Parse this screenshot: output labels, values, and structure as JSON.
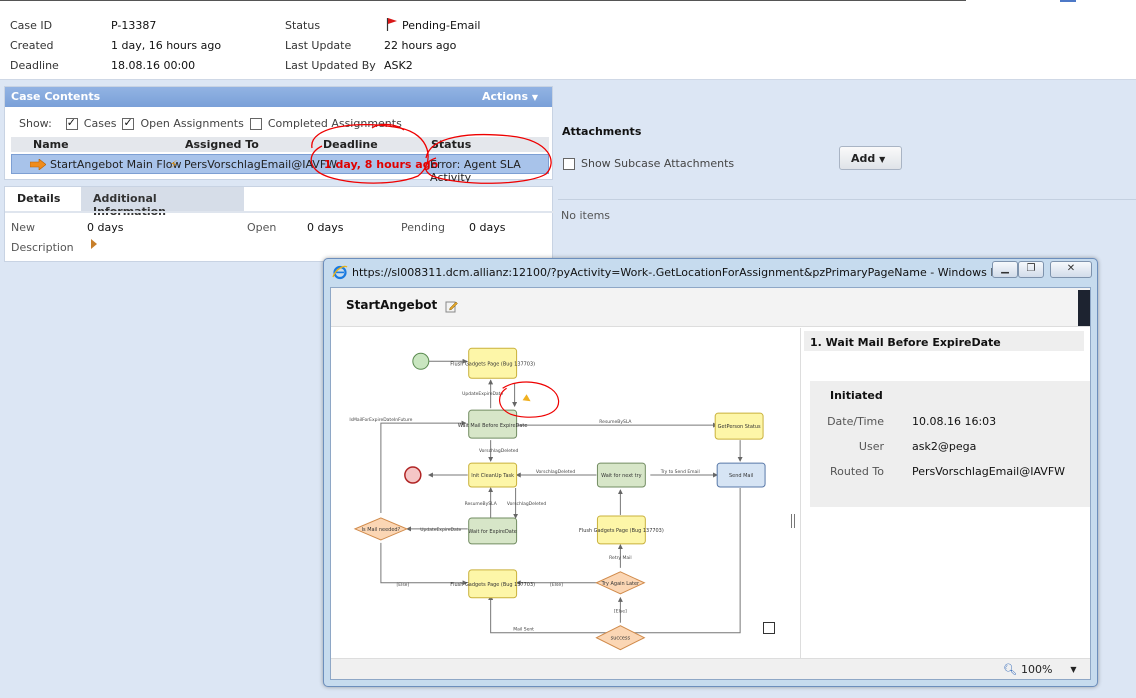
{
  "case": {
    "fields": [
      {
        "label": "Case ID",
        "value": "P-13387"
      },
      {
        "label": "Created",
        "value": "1 day, 16 hours ago"
      },
      {
        "label": "Deadline",
        "value": "18.08.16 00:00"
      },
      {
        "label": "Status",
        "value": "Pending-Email"
      },
      {
        "label": "Last Update",
        "value": "22 hours ago"
      },
      {
        "label": "Last Updated By",
        "value": "ASK2"
      }
    ]
  },
  "case_contents": {
    "title": "Case Contents",
    "actions": "Actions",
    "show_label": "Show:",
    "filters": [
      {
        "label": "Cases",
        "checked": true
      },
      {
        "label": "Open Assignments",
        "checked": true
      },
      {
        "label": "Completed Assignments",
        "checked": false
      }
    ],
    "columns": [
      "Name",
      "Assigned To",
      "Deadline",
      "Status"
    ],
    "row": {
      "name": "StartAngebot Main Flow",
      "assigned_to": "PersVorschlagEmail@IAVFW",
      "deadline": "1 day, 8 hours ago",
      "status": "Error: Agent SLA Activity"
    }
  },
  "details": {
    "tabs": [
      "Details",
      "Additional Information"
    ],
    "new_label": "New",
    "new_value": "0 days",
    "open_label": "Open",
    "open_value": "0 days",
    "pending_label": "Pending",
    "pending_value": "0 days",
    "description_label": "Description"
  },
  "attachments": {
    "title": "Attachments",
    "show_subcase": "Show Subcase Attachments",
    "add_label": "Add",
    "empty": "No items"
  },
  "popup": {
    "window_title": "https://sl008311.dcm.allianz:12100/?pyActivity=Work-.GetLocationForAssignment&pzPrimaryPageName - Windows I...",
    "flow_title": "StartAngebot",
    "step_title": "1. Wait Mail Before ExpireDate",
    "initiated": "Initiated",
    "rows": [
      {
        "label": "Date/Time",
        "value": "10.08.16 16:03"
      },
      {
        "label": "User",
        "value": "ask2@pega"
      },
      {
        "label": "Routed To",
        "value": "PersVorschlagEmail@IAVFW"
      }
    ],
    "zoom": "100%"
  },
  "flow": {
    "nodes": {
      "flush1": "Flush Gadgets Page (Bug 137703)",
      "wait_mail": "Wait Mail Before ExpireDate",
      "get_person": "GetPerson Status",
      "init_cleanup": "Init CleanUp Task",
      "wait_next": "Wait for next try",
      "send_mail": "Send Mail",
      "flush_right": "Flush Gadgets Page (Bug 137703)",
      "mail_needed": "Is Mail needed?",
      "wait_expire": "Wait for ExpireDate",
      "flush_bottom": "Flush Gadgets Page (Bug 137703)",
      "try_again": "Try Again Later",
      "success": "success"
    },
    "edges": {
      "update_expire_top": "UpdateExpireDate",
      "is_mail_future": "IsMailForExpireDateInFuture",
      "resume_sla": "ResumeBySLA",
      "vorschlag_deleted_1": "VorschlagDeleted",
      "vorschlag_deleted_2": "VorschlagDeleted",
      "try_send": "Try to Send Email",
      "resume_sla_2": "ResumeBySLA",
      "vorschlag_deleted_3": "VorschlagDeleted",
      "update_expire_bottom": "UpdateExpireDate",
      "retry_mail": "Retry Mail",
      "else_1": "[Else]",
      "else_2": "[Else]",
      "else_3": "[Else]",
      "mail_sent": "Mail Sent"
    }
  }
}
